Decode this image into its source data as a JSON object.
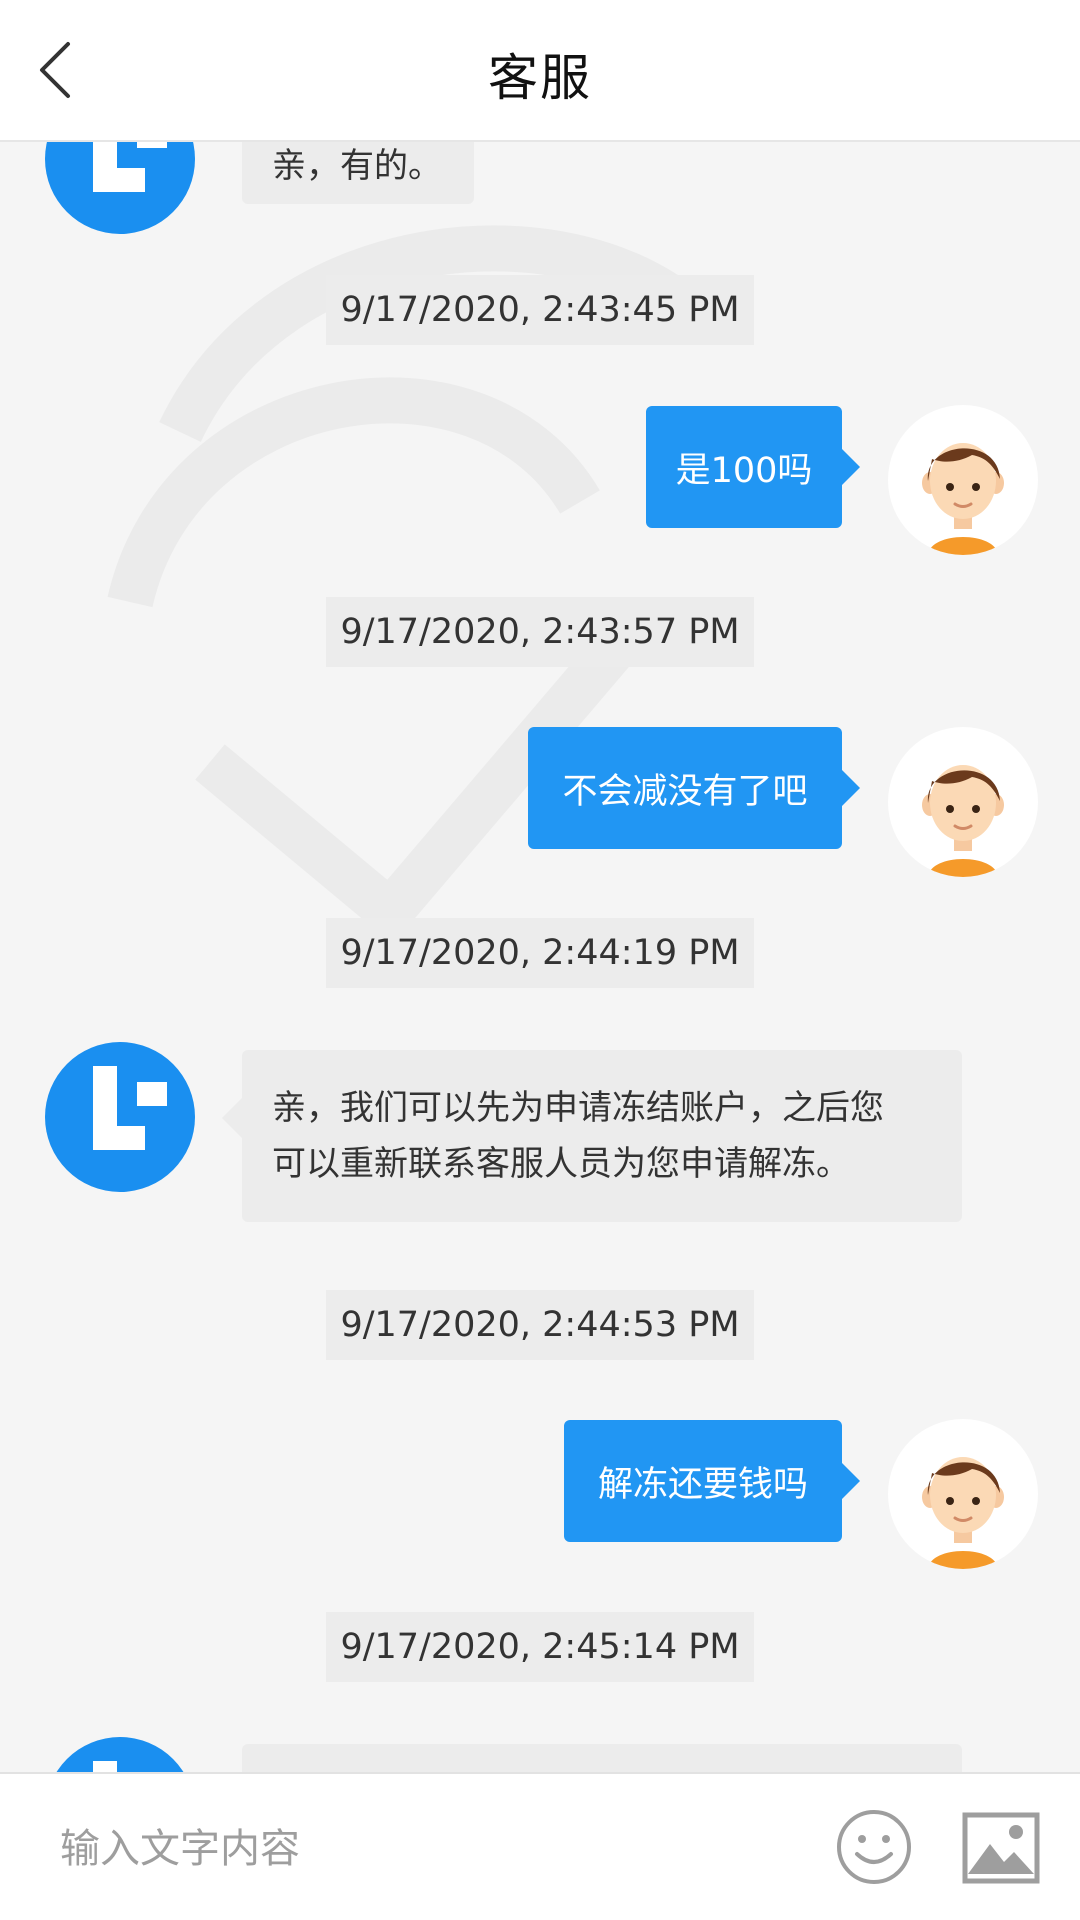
{
  "header": {
    "title": "客服",
    "back_icon": "chevron-left-icon"
  },
  "messages": [
    {
      "kind": "incoming",
      "text": "亲，有的。"
    },
    {
      "kind": "timestamp",
      "text": "9/17/2020, 2:43:45 PM"
    },
    {
      "kind": "outgoing",
      "text": "是100吗"
    },
    {
      "kind": "timestamp",
      "text": "9/17/2020, 2:43:57 PM"
    },
    {
      "kind": "outgoing",
      "text": "不会减没有了吧"
    },
    {
      "kind": "timestamp",
      "text": "9/17/2020, 2:44:19 PM"
    },
    {
      "kind": "incoming",
      "lines": [
        "亲，我们可以先为申请冻结账户，之后您",
        "可以重新联系客服人员为您申请解冻。"
      ]
    },
    {
      "kind": "timestamp",
      "text": "9/17/2020, 2:44:53 PM"
    },
    {
      "kind": "outgoing",
      "text": "解冻还要钱吗"
    },
    {
      "kind": "timestamp",
      "text": "9/17/2020, 2:45:14 PM"
    }
  ],
  "input": {
    "placeholder": "输入文字内容",
    "emoji_icon": "smiley-icon",
    "image_icon": "image-icon"
  },
  "colors": {
    "accent": "#2196f3",
    "background": "#f5f5f5",
    "incoming_bubble": "#ececec"
  }
}
